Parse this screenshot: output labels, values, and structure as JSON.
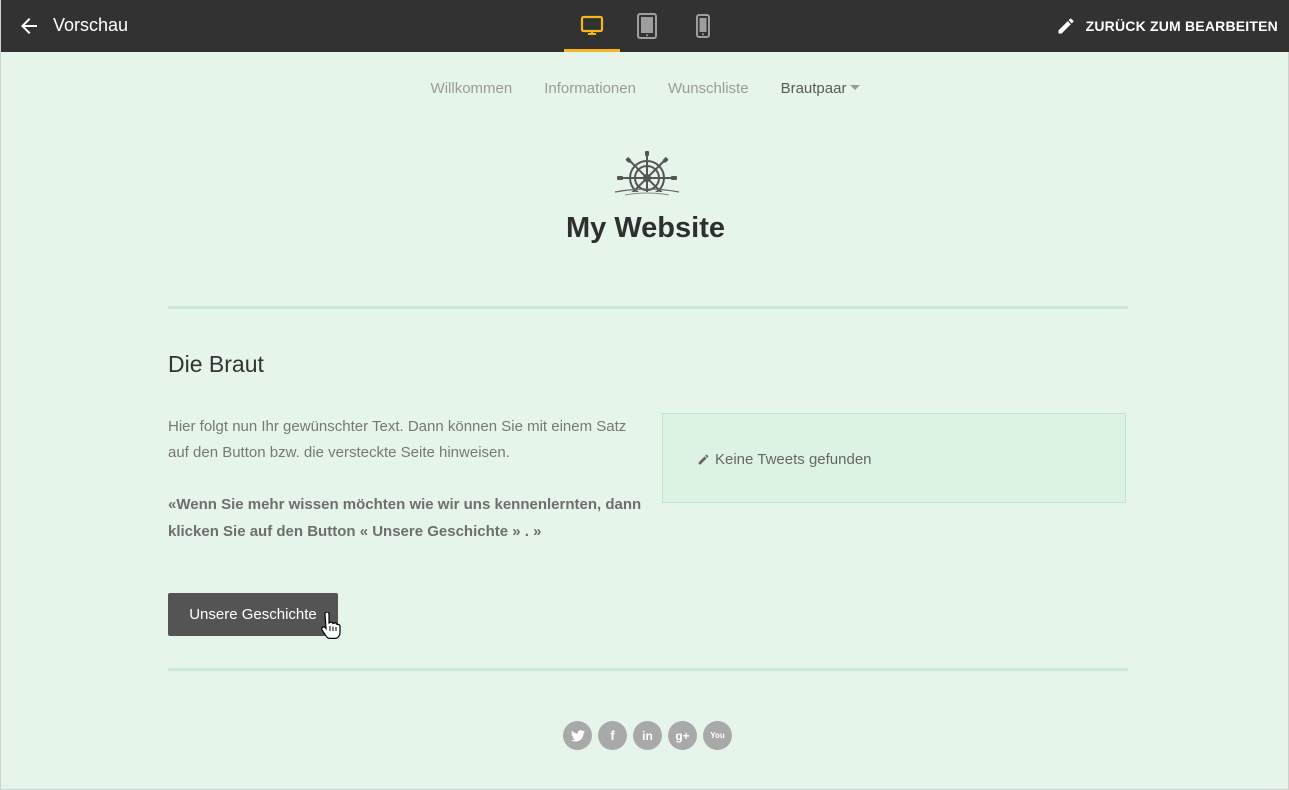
{
  "topbar": {
    "title": "Vorschau",
    "edit_label": "ZURÜCK ZUM BEARBEITEN",
    "accent_color": "#f5b51d",
    "devices": [
      "desktop-icon",
      "tablet-icon",
      "phone-icon"
    ],
    "active_device": "desktop"
  },
  "nav": {
    "items": [
      "Willkommen",
      "Informationen",
      "Wunschliste",
      "Brautpaar"
    ]
  },
  "site": {
    "title": "My Website"
  },
  "section": {
    "title": "Die Braut",
    "paragraph": "Hier folgt nun Ihr gewünschter Text. Dann können Sie mit einem Satz auf den Button bzw. die versteckte Seite hinweisen.",
    "quote": "«Wenn Sie mehr wissen möchten wie wir uns kennenlernten, dann klicken Sie auf den Button « Unsere Geschichte » . »",
    "button_label": "Unsere Geschichte"
  },
  "tweets": {
    "empty_message": "Keine Tweets gefunden"
  },
  "socials": {
    "icons": [
      "twitter-icon",
      "facebook-icon",
      "linkedin-icon",
      "google-plus-icon",
      "youtube-icon"
    ],
    "glyphs": [
      "t",
      "f",
      "in",
      "g+",
      "You"
    ]
  }
}
